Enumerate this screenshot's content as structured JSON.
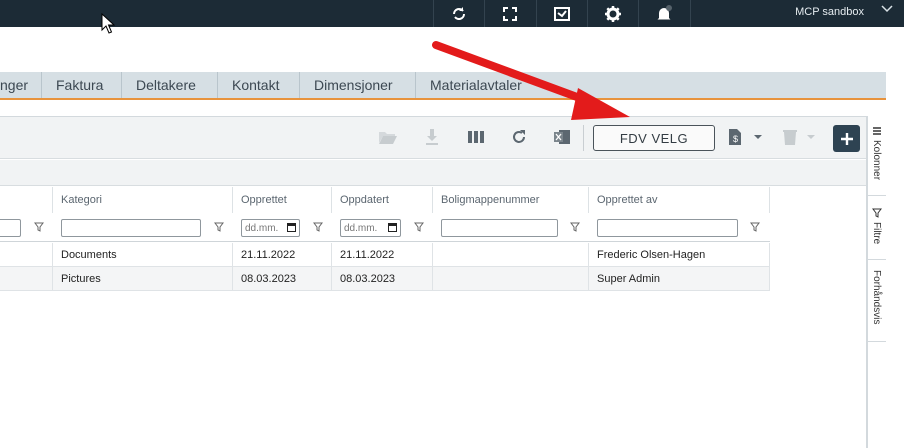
{
  "topbar": {
    "tenant": "MCP sandbox",
    "icons": [
      "sync-icon",
      "fullscreen-icon",
      "inbox-icon",
      "gear-icon",
      "bell-icon"
    ]
  },
  "tabs": [
    {
      "label": "nger"
    },
    {
      "label": "Faktura"
    },
    {
      "label": "Deltakere"
    },
    {
      "label": "Kontakt"
    },
    {
      "label": "Dimensjoner"
    },
    {
      "label": "Materialavtaler"
    }
  ],
  "toolbar": {
    "fdv_label": "FDV VELG",
    "add_label": "+"
  },
  "grid": {
    "columns": [
      "Kategori",
      "Opprettet",
      "Oppdatert",
      "Boligmappenummer",
      "Opprettet av"
    ],
    "date_placeholder": "dd.mm.",
    "rows": [
      {
        "kategori": "Documents",
        "opprettet": "21.11.2022",
        "oppdatert": "21.11.2022",
        "boligmappenummer": "",
        "opprettet_av": "Frederic Olsen-Hagen"
      },
      {
        "kategori": "Pictures",
        "opprettet": "08.03.2023",
        "oppdatert": "08.03.2023",
        "boligmappenummer": "",
        "opprettet_av": "Super Admin"
      }
    ]
  },
  "side_tabs": [
    "Kolonner",
    "Filtre",
    "Forhåndsvis"
  ],
  "colors": {
    "topbar": "#1c2b36",
    "tab_accent": "#e8933c",
    "annotation_arrow": "#e31b1b",
    "add_button": "#2e4352"
  }
}
